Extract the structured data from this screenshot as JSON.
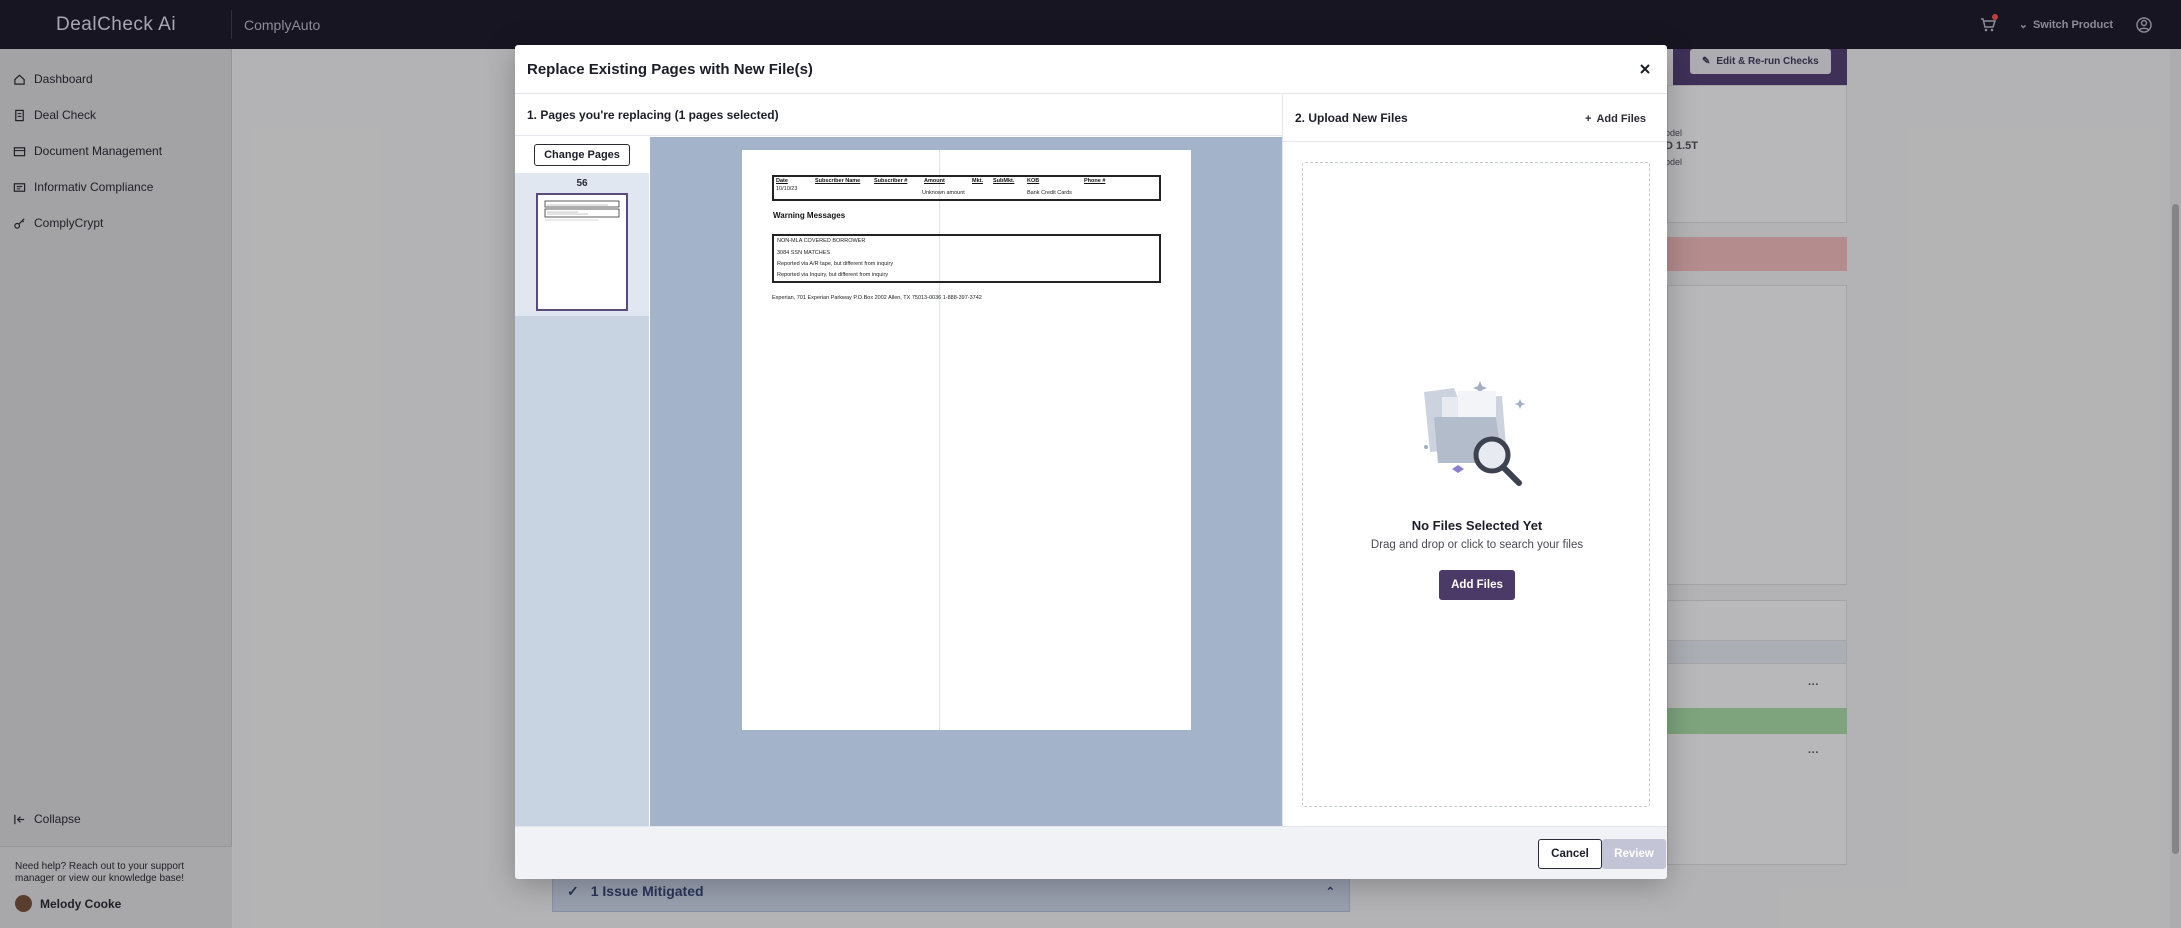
{
  "app": {
    "logo": "DealCheck Ai",
    "product": "ComplyAuto",
    "switch_product": "Switch Product",
    "accent": "#4b3a68"
  },
  "sidebar": {
    "items": [
      {
        "label": "Dashboard",
        "icon": "home-icon"
      },
      {
        "label": "Deal Check",
        "icon": "document-icon"
      },
      {
        "label": "Document Management",
        "icon": "folder-icon"
      },
      {
        "label": "Informativ Compliance",
        "icon": "id-card-icon"
      },
      {
        "label": "ComplyCrypt",
        "icon": "key-icon"
      }
    ],
    "collapse": "Collapse",
    "help_text": "Need help? Reach out to your support manager or view our knowledge base!",
    "user_name": "Melody Cooke"
  },
  "background": {
    "rerun_button": "Edit & Re-run Checks",
    "model_label_1": "odel",
    "model_value": "D 1.5T",
    "model_label_2": "odel",
    "mitigated": "1 Issue Mitigated",
    "ellipsis": "···"
  },
  "modal": {
    "title": "Replace Existing Pages with New File(s)",
    "left_heading": "1. Pages you're replacing (1 pages selected)",
    "change_pages": "Change Pages",
    "page_number": "56",
    "right_heading": "2. Upload New Files",
    "add_files_link": "Add Files",
    "empty_title": "No Files Selected Yet",
    "empty_subtitle": "Drag and drop or click to search your files",
    "add_files_button": "Add Files",
    "cancel": "Cancel",
    "review": "Review"
  },
  "document": {
    "headers": [
      "Date",
      "Subscriber Name",
      "Subscriber #",
      "Amount",
      "Mkt.",
      "SubMkt.",
      "KOB",
      "Phone #"
    ],
    "row_date": "10/10/23",
    "row_amount": "Unknown amount",
    "row_kob": "Bank Credit Cards",
    "warning_title": "Warning Messages",
    "warnings": [
      "NON-MLA COVERED BORROWER",
      "3084 SSN MATCHES",
      "Reported via A/R tape, but different from inquiry",
      "Reported via Inquiry, but different from inquiry"
    ],
    "footer": "Experian, 701 Experian Parkway P.O.Box 2002 Allen, TX 75013-0036 1-888-397-3742"
  }
}
